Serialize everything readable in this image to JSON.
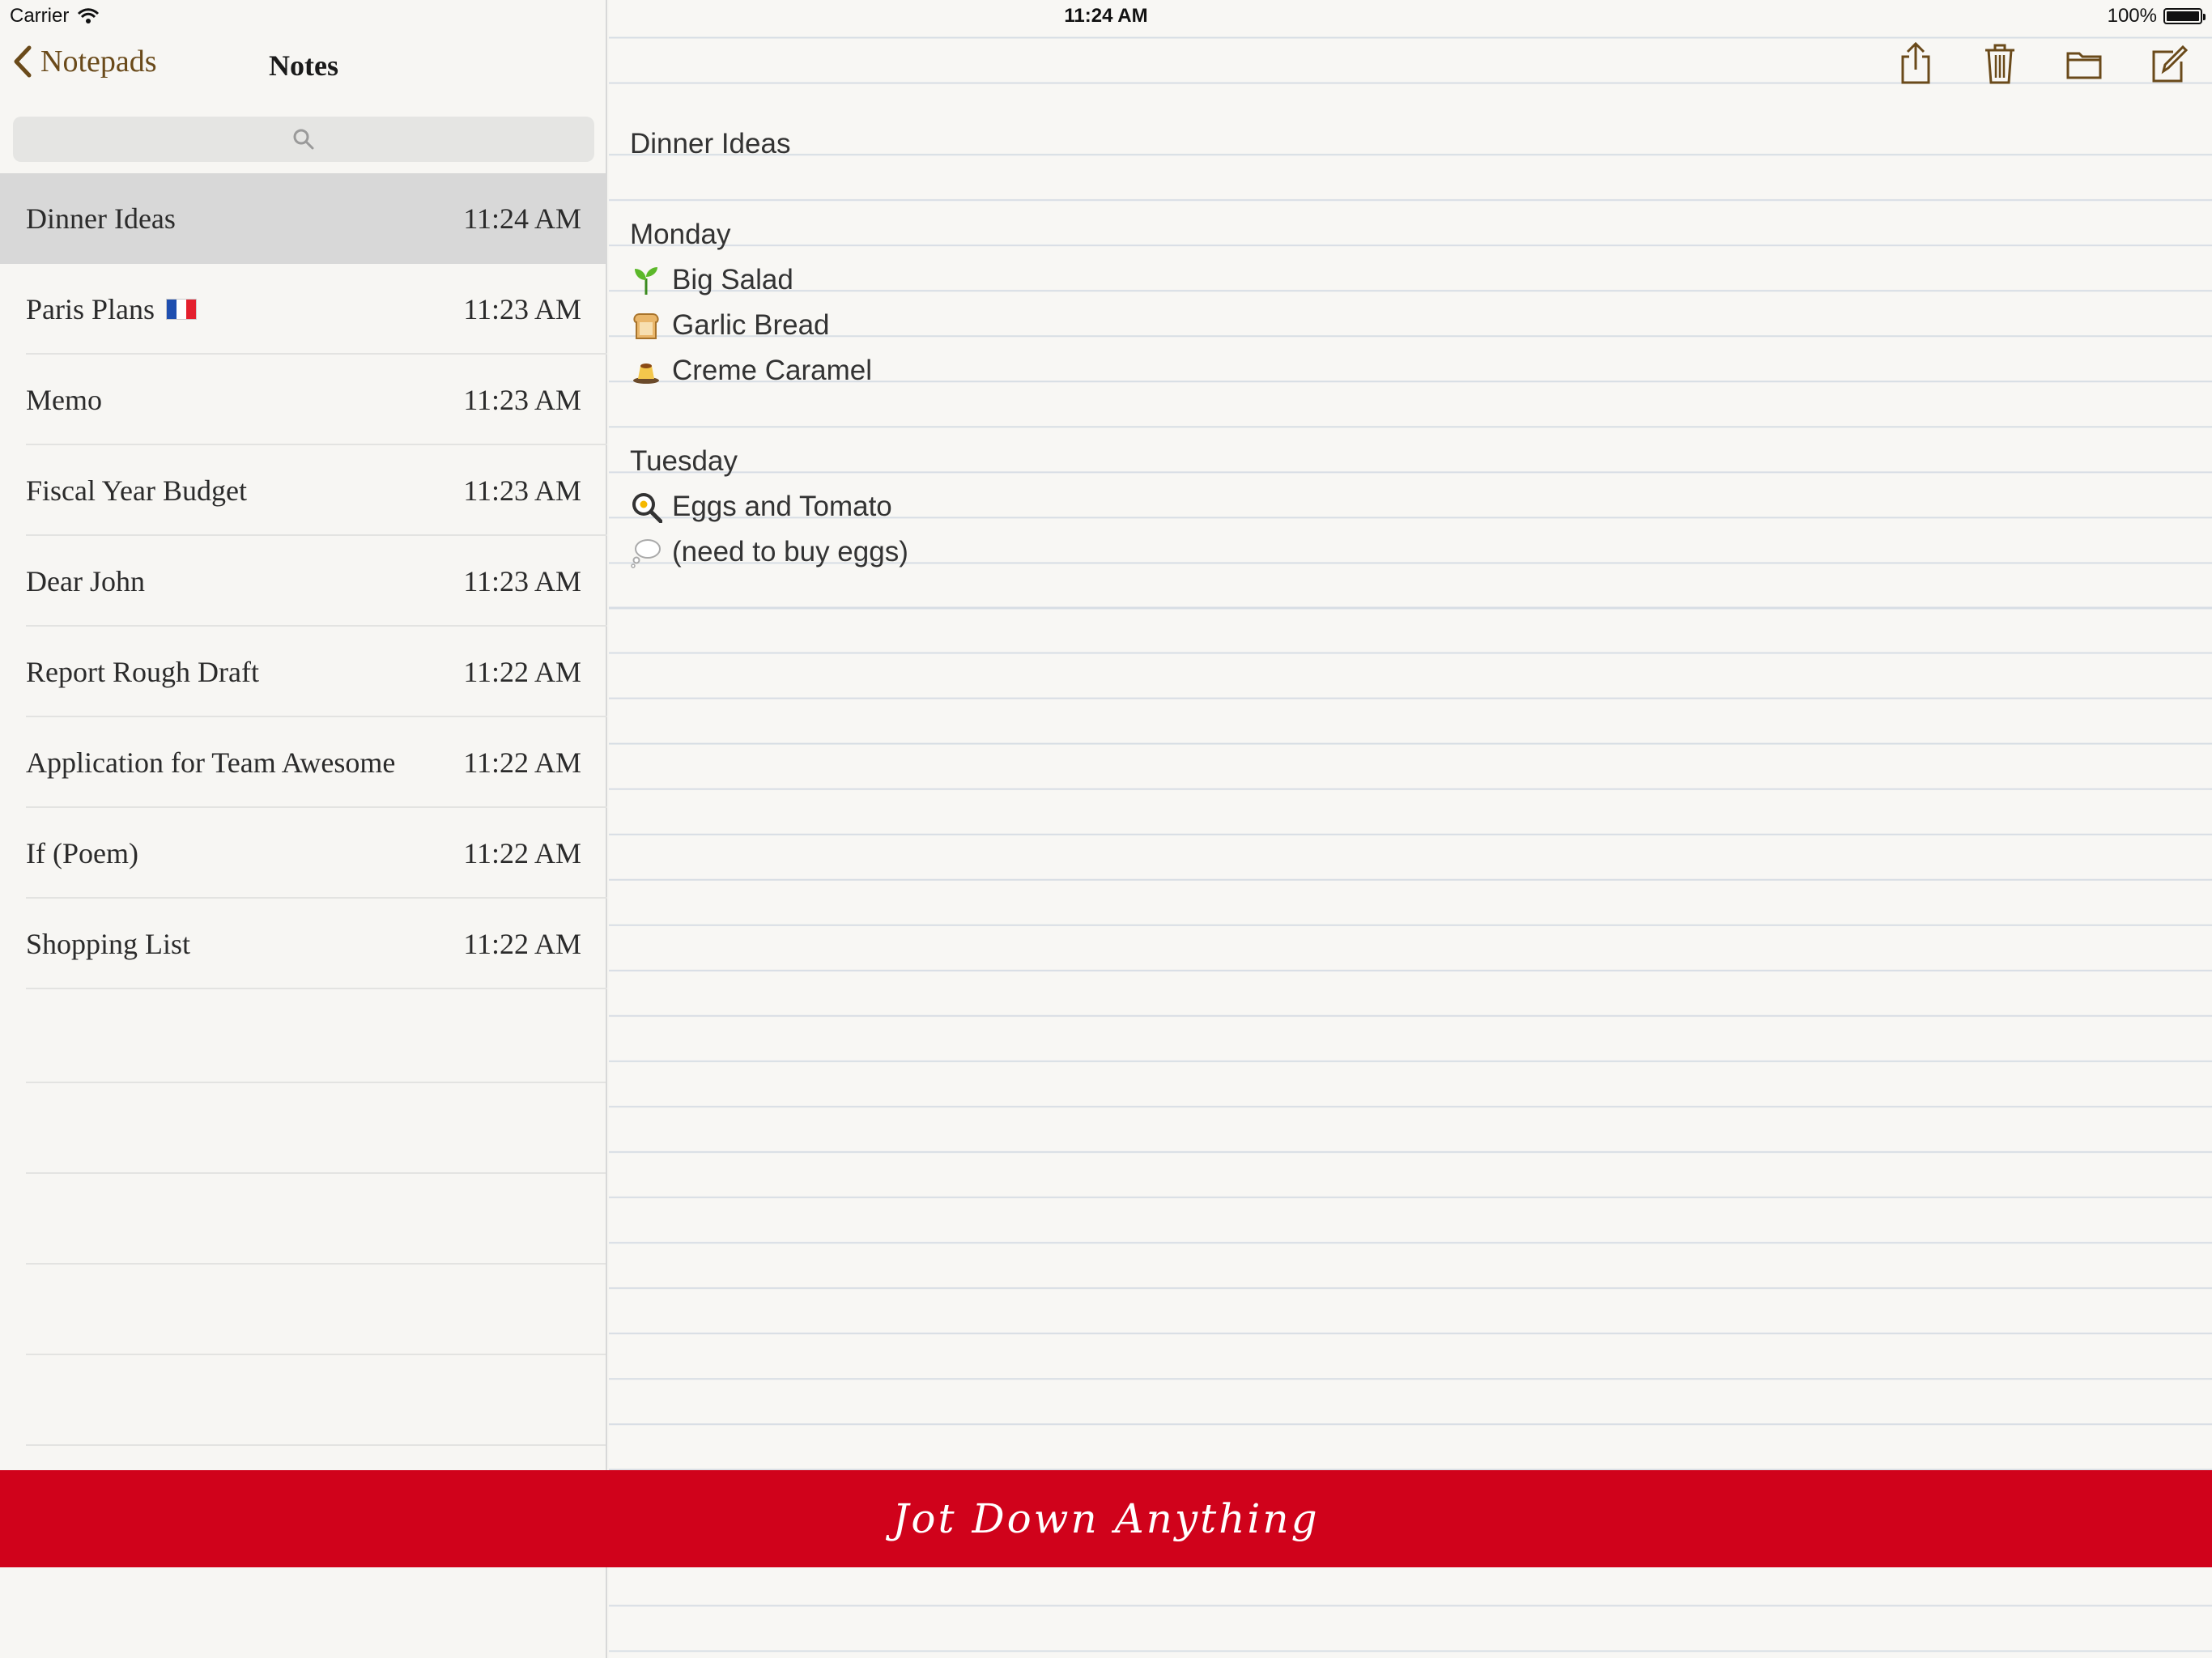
{
  "status_bar": {
    "carrier": "Carrier",
    "time": "11:24 AM",
    "battery": "100%",
    "battery_level": 1.0
  },
  "sidebar": {
    "back_label": "Notepads",
    "title": "Notes",
    "search_icon": "search-icon",
    "notes": [
      {
        "title": "Dinner Ideas",
        "time": "11:24 AM",
        "selected": true
      },
      {
        "title": "Paris Plans",
        "time": "11:23 AM",
        "flag": "fr"
      },
      {
        "title": "Memo",
        "time": "11:23 AM"
      },
      {
        "title": "Fiscal Year Budget",
        "time": "11:23 AM"
      },
      {
        "title": "Dear John",
        "time": "11:23 AM"
      },
      {
        "title": "Report Rough Draft",
        "time": "11:22 AM"
      },
      {
        "title": "Application for Team Awesome",
        "time": "11:22 AM"
      },
      {
        "title": "If (Poem)",
        "time": "11:22 AM"
      },
      {
        "title": "Shopping List",
        "time": "11:22 AM"
      }
    ]
  },
  "toolbar": {
    "share_icon": "share-icon",
    "trash_icon": "trash-icon",
    "folder_icon": "folder-icon",
    "compose_icon": "compose-icon"
  },
  "note": {
    "lines": [
      {
        "text": "Dinner Ideas"
      },
      {
        "text": ""
      },
      {
        "text": "Monday"
      },
      {
        "text": "Big Salad",
        "icon": "seedling-icon"
      },
      {
        "text": "Garlic Bread",
        "icon": "bread-icon"
      },
      {
        "text": "Creme Caramel",
        "icon": "custard-icon"
      },
      {
        "text": ""
      },
      {
        "text": "Tuesday"
      },
      {
        "text": "Eggs and Tomato",
        "icon": "frying-pan-icon"
      },
      {
        "text": "(need to buy eggs)",
        "icon": "thought-bubble-icon"
      }
    ]
  },
  "banner": {
    "text": "Jot Down Anything",
    "color": "#d0021b"
  }
}
